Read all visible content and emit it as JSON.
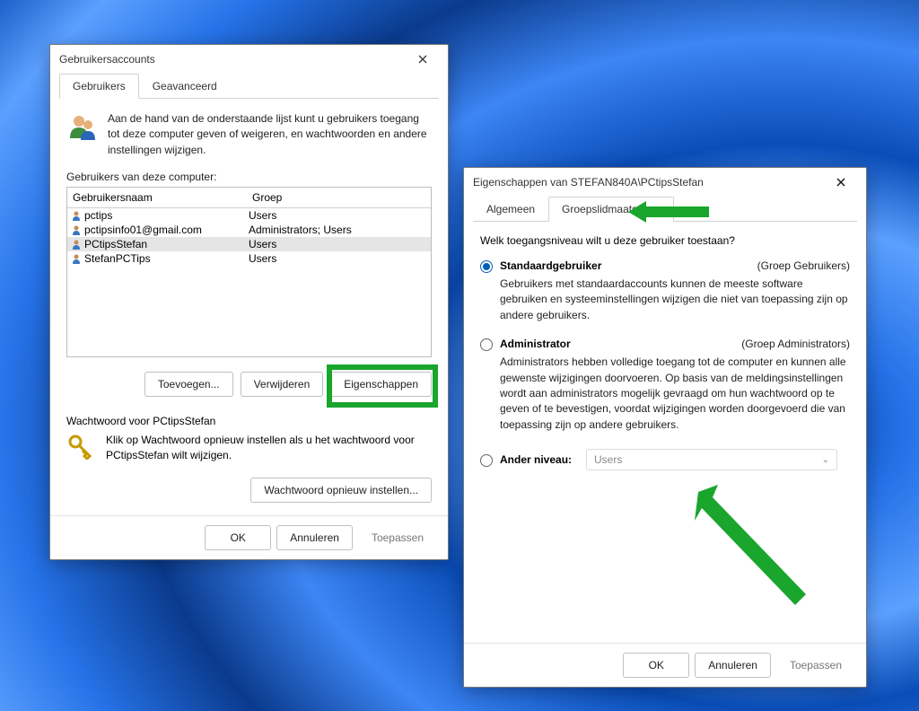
{
  "accountsDialog": {
    "title": "Gebruikersaccounts",
    "tabs": {
      "users": "Gebruikers",
      "advanced": "Geavanceerd"
    },
    "intro": "Aan de hand van de onderstaande lijst kunt u gebruikers toegang tot deze computer geven of weigeren, en wachtwoorden en andere instellingen wijzigen.",
    "listLabel": "Gebruikers van deze computer:",
    "columns": {
      "username": "Gebruikersnaam",
      "group": "Groep"
    },
    "rows": [
      {
        "name": "pctips",
        "group": "Users"
      },
      {
        "name": "pctipsinfo01@gmail.com",
        "group": "Administrators; Users"
      },
      {
        "name": "PCtipsStefan",
        "group": "Users"
      },
      {
        "name": "StefanPCTips",
        "group": "Users"
      }
    ],
    "buttons": {
      "add": "Toevoegen...",
      "remove": "Verwijderen",
      "properties": "Eigenschappen"
    },
    "password": {
      "title": "Wachtwoord voor PCtipsStefan",
      "desc": "Klik op Wachtwoord opnieuw instellen als u het wachtwoord voor PCtipsStefan wilt wijzigen.",
      "reset": "Wachtwoord opnieuw instellen..."
    },
    "footer": {
      "ok": "OK",
      "cancel": "Annuleren",
      "apply": "Toepassen"
    }
  },
  "propsDialog": {
    "title": "Eigenschappen van STEFAN840A\\PCtipsStefan",
    "tabs": {
      "general": "Algemeen",
      "membership": "Groepslidmaatschap"
    },
    "question": "Welk toegangsniveau wilt u deze gebruiker toestaan?",
    "options": {
      "standard": {
        "label": "Standaardgebruiker",
        "aside": "(Groep Gebruikers)",
        "desc": "Gebruikers met standaardaccounts kunnen de meeste software gebruiken en systeeminstellingen wijzigen die niet van toepassing zijn op andere gebruikers."
      },
      "admin": {
        "label": "Administrator",
        "aside": "(Groep Administrators)",
        "desc": "Administrators hebben volledige toegang tot de computer en kunnen alle gewenste wijzigingen doorvoeren. Op basis van de meldingsinstellingen wordt aan administrators mogelijk gevraagd om hun wachtwoord op te geven of te bevestigen, voordat wijzigingen worden doorgevoerd die van toepassing zijn op andere gebruikers."
      },
      "other": {
        "label": "Ander niveau:",
        "value": "Users"
      }
    },
    "footer": {
      "ok": "OK",
      "cancel": "Annuleren",
      "apply": "Toepassen"
    }
  }
}
